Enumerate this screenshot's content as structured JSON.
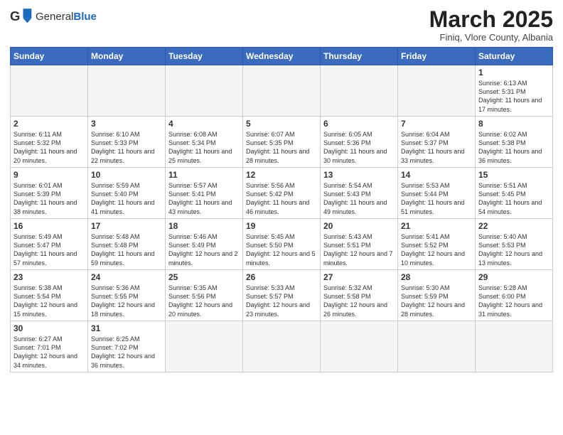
{
  "logo": {
    "text_general": "General",
    "text_blue": "Blue"
  },
  "title": "March 2025",
  "subtitle": "Finiq, Vlore County, Albania",
  "weekdays": [
    "Sunday",
    "Monday",
    "Tuesday",
    "Wednesday",
    "Thursday",
    "Friday",
    "Saturday"
  ],
  "weeks": [
    [
      {
        "day": "",
        "info": ""
      },
      {
        "day": "",
        "info": ""
      },
      {
        "day": "",
        "info": ""
      },
      {
        "day": "",
        "info": ""
      },
      {
        "day": "",
        "info": ""
      },
      {
        "day": "",
        "info": ""
      },
      {
        "day": "1",
        "info": "Sunrise: 6:13 AM\nSunset: 5:31 PM\nDaylight: 11 hours\nand 17 minutes."
      }
    ],
    [
      {
        "day": "2",
        "info": "Sunrise: 6:11 AM\nSunset: 5:32 PM\nDaylight: 11 hours\nand 20 minutes."
      },
      {
        "day": "3",
        "info": "Sunrise: 6:10 AM\nSunset: 5:33 PM\nDaylight: 11 hours\nand 22 minutes."
      },
      {
        "day": "4",
        "info": "Sunrise: 6:08 AM\nSunset: 5:34 PM\nDaylight: 11 hours\nand 25 minutes."
      },
      {
        "day": "5",
        "info": "Sunrise: 6:07 AM\nSunset: 5:35 PM\nDaylight: 11 hours\nand 28 minutes."
      },
      {
        "day": "6",
        "info": "Sunrise: 6:05 AM\nSunset: 5:36 PM\nDaylight: 11 hours\nand 30 minutes."
      },
      {
        "day": "7",
        "info": "Sunrise: 6:04 AM\nSunset: 5:37 PM\nDaylight: 11 hours\nand 33 minutes."
      },
      {
        "day": "8",
        "info": "Sunrise: 6:02 AM\nSunset: 5:38 PM\nDaylight: 11 hours\nand 36 minutes."
      }
    ],
    [
      {
        "day": "9",
        "info": "Sunrise: 6:01 AM\nSunset: 5:39 PM\nDaylight: 11 hours\nand 38 minutes."
      },
      {
        "day": "10",
        "info": "Sunrise: 5:59 AM\nSunset: 5:40 PM\nDaylight: 11 hours\nand 41 minutes."
      },
      {
        "day": "11",
        "info": "Sunrise: 5:57 AM\nSunset: 5:41 PM\nDaylight: 11 hours\nand 43 minutes."
      },
      {
        "day": "12",
        "info": "Sunrise: 5:56 AM\nSunset: 5:42 PM\nDaylight: 11 hours\nand 46 minutes."
      },
      {
        "day": "13",
        "info": "Sunrise: 5:54 AM\nSunset: 5:43 PM\nDaylight: 11 hours\nand 49 minutes."
      },
      {
        "day": "14",
        "info": "Sunrise: 5:53 AM\nSunset: 5:44 PM\nDaylight: 11 hours\nand 51 minutes."
      },
      {
        "day": "15",
        "info": "Sunrise: 5:51 AM\nSunset: 5:45 PM\nDaylight: 11 hours\nand 54 minutes."
      }
    ],
    [
      {
        "day": "16",
        "info": "Sunrise: 5:49 AM\nSunset: 5:47 PM\nDaylight: 11 hours\nand 57 minutes."
      },
      {
        "day": "17",
        "info": "Sunrise: 5:48 AM\nSunset: 5:48 PM\nDaylight: 11 hours\nand 59 minutes."
      },
      {
        "day": "18",
        "info": "Sunrise: 5:46 AM\nSunset: 5:49 PM\nDaylight: 12 hours\nand 2 minutes."
      },
      {
        "day": "19",
        "info": "Sunrise: 5:45 AM\nSunset: 5:50 PM\nDaylight: 12 hours\nand 5 minutes."
      },
      {
        "day": "20",
        "info": "Sunrise: 5:43 AM\nSunset: 5:51 PM\nDaylight: 12 hours\nand 7 minutes."
      },
      {
        "day": "21",
        "info": "Sunrise: 5:41 AM\nSunset: 5:52 PM\nDaylight: 12 hours\nand 10 minutes."
      },
      {
        "day": "22",
        "info": "Sunrise: 5:40 AM\nSunset: 5:53 PM\nDaylight: 12 hours\nand 13 minutes."
      }
    ],
    [
      {
        "day": "23",
        "info": "Sunrise: 5:38 AM\nSunset: 5:54 PM\nDaylight: 12 hours\nand 15 minutes."
      },
      {
        "day": "24",
        "info": "Sunrise: 5:36 AM\nSunset: 5:55 PM\nDaylight: 12 hours\nand 18 minutes."
      },
      {
        "day": "25",
        "info": "Sunrise: 5:35 AM\nSunset: 5:56 PM\nDaylight: 12 hours\nand 20 minutes."
      },
      {
        "day": "26",
        "info": "Sunrise: 5:33 AM\nSunset: 5:57 PM\nDaylight: 12 hours\nand 23 minutes."
      },
      {
        "day": "27",
        "info": "Sunrise: 5:32 AM\nSunset: 5:58 PM\nDaylight: 12 hours\nand 26 minutes."
      },
      {
        "day": "28",
        "info": "Sunrise: 5:30 AM\nSunset: 5:59 PM\nDaylight: 12 hours\nand 28 minutes."
      },
      {
        "day": "29",
        "info": "Sunrise: 5:28 AM\nSunset: 6:00 PM\nDaylight: 12 hours\nand 31 minutes."
      }
    ],
    [
      {
        "day": "30",
        "info": "Sunrise: 6:27 AM\nSunset: 7:01 PM\nDaylight: 12 hours\nand 34 minutes."
      },
      {
        "day": "31",
        "info": "Sunrise: 6:25 AM\nSunset: 7:02 PM\nDaylight: 12 hours\nand 36 minutes."
      },
      {
        "day": "",
        "info": ""
      },
      {
        "day": "",
        "info": ""
      },
      {
        "day": "",
        "info": ""
      },
      {
        "day": "",
        "info": ""
      },
      {
        "day": "",
        "info": ""
      }
    ]
  ]
}
